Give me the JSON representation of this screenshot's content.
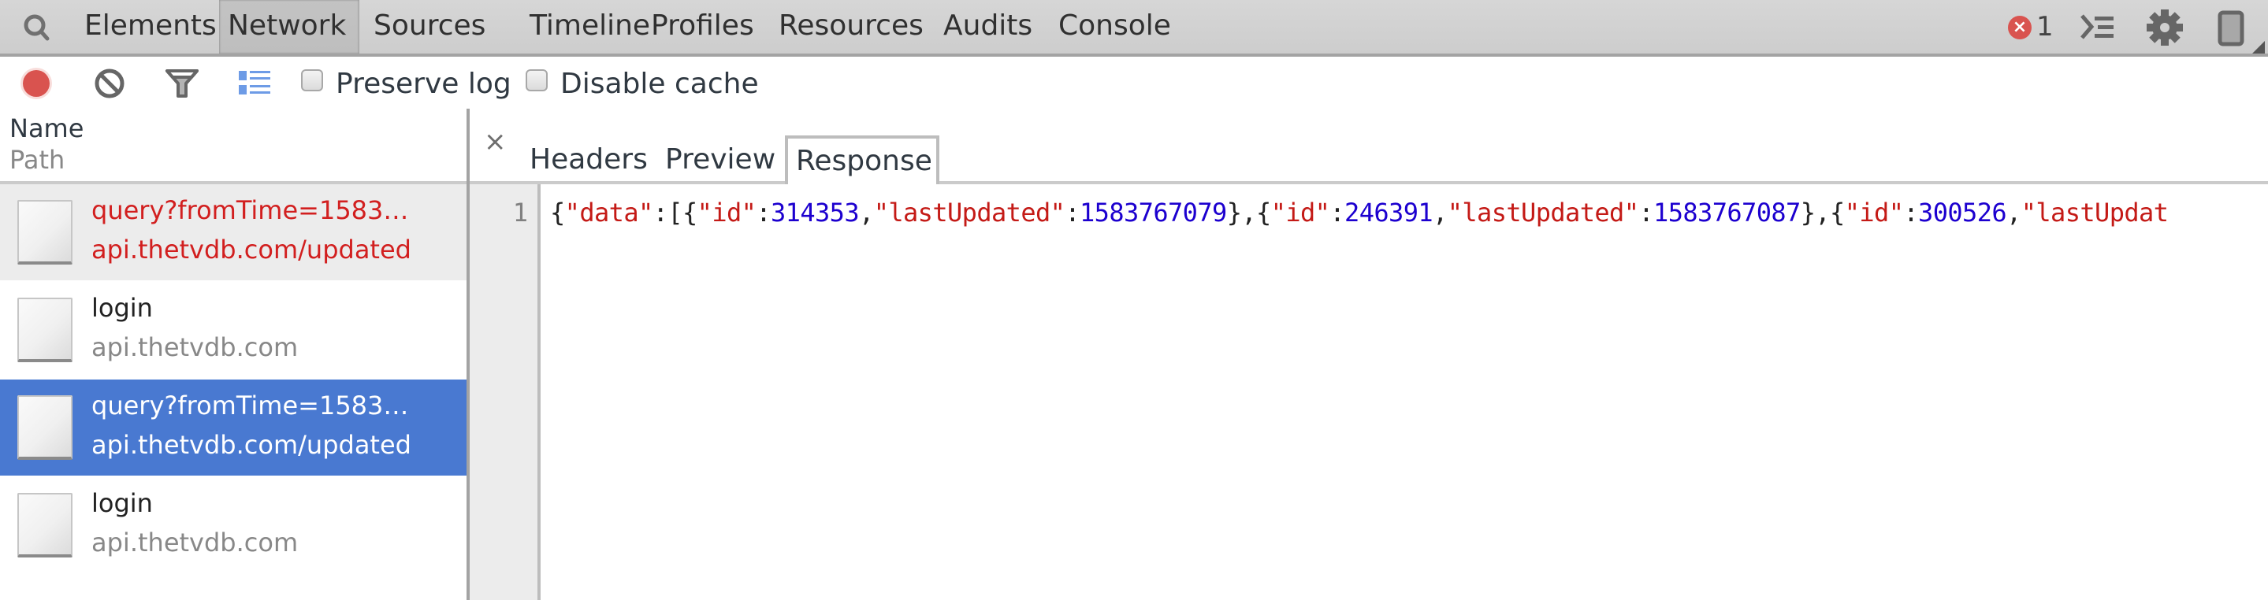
{
  "topbar": {
    "tabs": [
      {
        "label": "Elements",
        "selected": false
      },
      {
        "label": "Network",
        "selected": true
      },
      {
        "label": "Sources",
        "selected": false
      },
      {
        "label": "Timeline",
        "selected": false
      },
      {
        "label": "Profiles",
        "selected": false
      },
      {
        "label": "Resources",
        "selected": false
      },
      {
        "label": "Audits",
        "selected": false
      },
      {
        "label": "Console",
        "selected": false
      }
    ],
    "error_count": "1",
    "icons": {
      "search": "search-icon",
      "error": "error-icon",
      "console_drawer": "console-drawer-icon",
      "settings": "gear-icon",
      "dock": "dock-side-icon"
    }
  },
  "toolbar": {
    "record_color": "#d9534f",
    "preserve_log": {
      "label": "Preserve log",
      "checked": false
    },
    "disable_cache": {
      "label": "Disable cache",
      "checked": false
    }
  },
  "request_list": {
    "header": {
      "name": "Name",
      "path": "Path"
    },
    "rows": [
      {
        "name": "query?fromTime=1583…",
        "path": "api.thetvdb.com/updated",
        "state": "error"
      },
      {
        "name": "login",
        "path": "api.thetvdb.com",
        "state": "normal"
      },
      {
        "name": "query?fromTime=1583…",
        "path": "api.thetvdb.com/updated",
        "state": "selected"
      },
      {
        "name": "login",
        "path": "api.thetvdb.com",
        "state": "normal"
      }
    ]
  },
  "detail": {
    "close_label": "×",
    "tabs": [
      {
        "label": "Headers",
        "selected": false
      },
      {
        "label": "Preview",
        "selected": false
      },
      {
        "label": "Response",
        "selected": true
      }
    ],
    "line_number": "1",
    "response_tokens": [
      {
        "t": "p",
        "v": "{"
      },
      {
        "t": "k",
        "v": "\"data\""
      },
      {
        "t": "p",
        "v": ":[{"
      },
      {
        "t": "k",
        "v": "\"id\""
      },
      {
        "t": "p",
        "v": ":"
      },
      {
        "t": "n",
        "v": "314353"
      },
      {
        "t": "p",
        "v": ","
      },
      {
        "t": "k",
        "v": "\"lastUpdated\""
      },
      {
        "t": "p",
        "v": ":"
      },
      {
        "t": "n",
        "v": "1583767079"
      },
      {
        "t": "p",
        "v": "},{"
      },
      {
        "t": "k",
        "v": "\"id\""
      },
      {
        "t": "p",
        "v": ":"
      },
      {
        "t": "n",
        "v": "246391"
      },
      {
        "t": "p",
        "v": ","
      },
      {
        "t": "k",
        "v": "\"lastUpdated\""
      },
      {
        "t": "p",
        "v": ":"
      },
      {
        "t": "n",
        "v": "1583767087"
      },
      {
        "t": "p",
        "v": "},{"
      },
      {
        "t": "k",
        "v": "\"id\""
      },
      {
        "t": "p",
        "v": ":"
      },
      {
        "t": "n",
        "v": "300526"
      },
      {
        "t": "p",
        "v": ","
      },
      {
        "t": "k",
        "v": "\"lastUpdat"
      }
    ],
    "colors": {
      "key": "#c41a16",
      "number": "#1c00cf",
      "punct": "#222222"
    }
  },
  "colors": {
    "selection": "#4979d1",
    "error_text": "#d21f1f",
    "error_row_bg": "#ececec"
  }
}
